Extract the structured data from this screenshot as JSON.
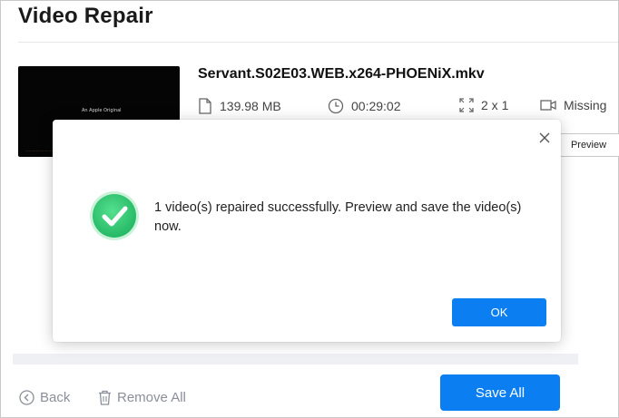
{
  "app": {
    "title": "Video Repair"
  },
  "video": {
    "thumbnail_caption": "An Apple Original",
    "file_name": "Servant.S02E03.WEB.x264-PHOENiX.mkv",
    "size": "139.98  MB",
    "duration": "00:29:02",
    "resolution": "2 x 1",
    "audio": "Missing",
    "preview_label": "Preview"
  },
  "footer": {
    "back_label": "Back",
    "remove_all_label": "Remove All",
    "save_all_label": "Save All"
  },
  "dialog": {
    "message": "1 video(s) repaired successfully. Preview and save the video(s) now.",
    "ok_label": "OK"
  },
  "colors": {
    "accent": "#0b7ff2",
    "success": "#3ecf7a",
    "muted_text": "#8a8f99"
  },
  "icons": {
    "size": "file-icon",
    "duration": "clock-icon",
    "resolution": "expand-icon",
    "audio": "video-camera-icon",
    "back": "back-circle-icon",
    "remove": "trash-icon",
    "close": "close-icon",
    "success": "check-circle-icon"
  }
}
